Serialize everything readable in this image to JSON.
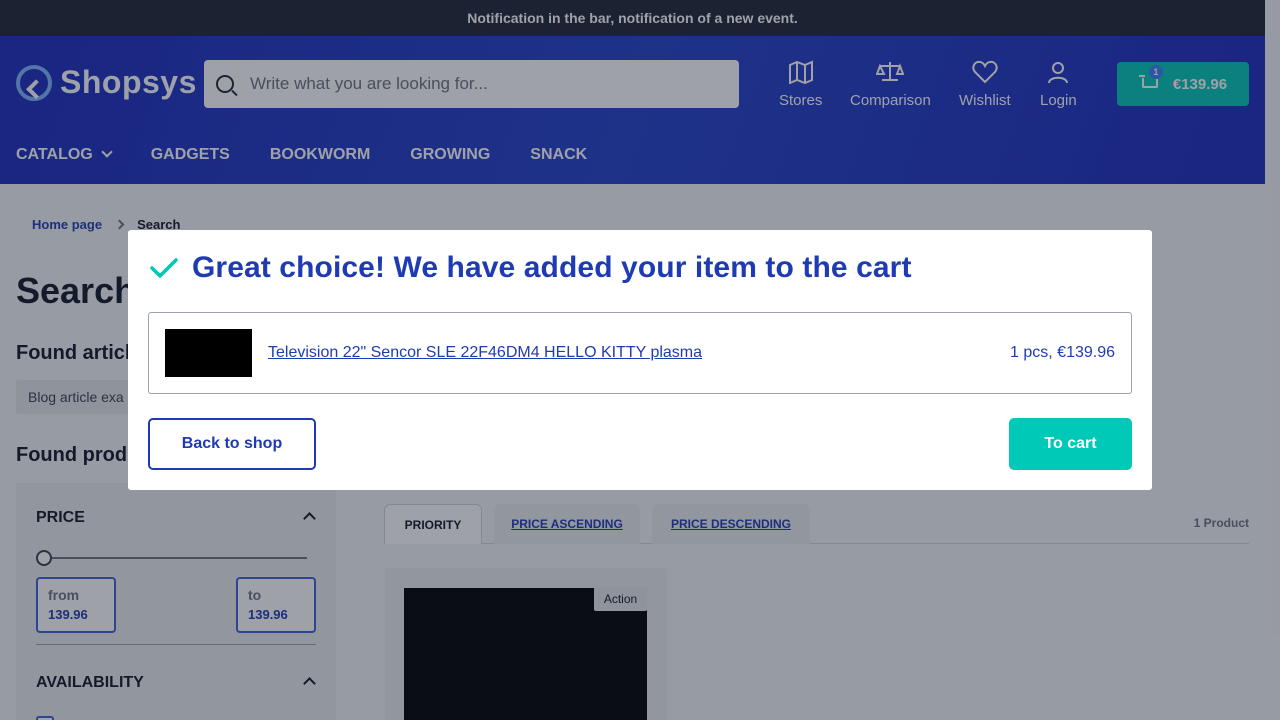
{
  "notification": {
    "text": "Notification in the bar, notification of a new event."
  },
  "header": {
    "logo_text": "Shopsys",
    "search_placeholder": "Write what you are looking for...",
    "nav": [
      {
        "label": "Stores",
        "icon": "map-icon"
      },
      {
        "label": "Comparison",
        "icon": "scale-icon"
      },
      {
        "label": "Wishlist",
        "icon": "heart-icon"
      },
      {
        "label": "Login",
        "icon": "user-icon"
      }
    ],
    "cart": {
      "count": "1",
      "total": "€139.96"
    },
    "menu": [
      "CATALOG",
      "GADGETS",
      "BOOKWORM",
      "GROWING",
      "SNACK"
    ]
  },
  "breadcrumb": {
    "home": "Home page",
    "current": "Search"
  },
  "page": {
    "title": "Search",
    "found_articles": "Found articl",
    "article_chip": "Blog article exa",
    "found_products": "Found prod"
  },
  "filters": {
    "price_title": "PRICE",
    "from_label": "from",
    "from_value": "139.96",
    "to_label": "to",
    "to_value": "139.96",
    "availability_title": "AVAILABILITY"
  },
  "sort_tabs": [
    "PRIORITY",
    "PRICE ASCENDING",
    "PRICE DESCENDING"
  ],
  "product_count": "1 Product",
  "product": {
    "badge": "Action"
  },
  "modal": {
    "title": "Great choice! We have added your item to the cart",
    "item_name": "Television 22\" Sencor SLE 22F46DM4 HELLO KITTY plasma",
    "item_qty_price": "1 pcs, €139.96",
    "back_label": "Back to shop",
    "cart_label": "To cart"
  },
  "colors": {
    "brand_blue": "#1f3bb3",
    "accent_teal": "#00c9b7"
  }
}
